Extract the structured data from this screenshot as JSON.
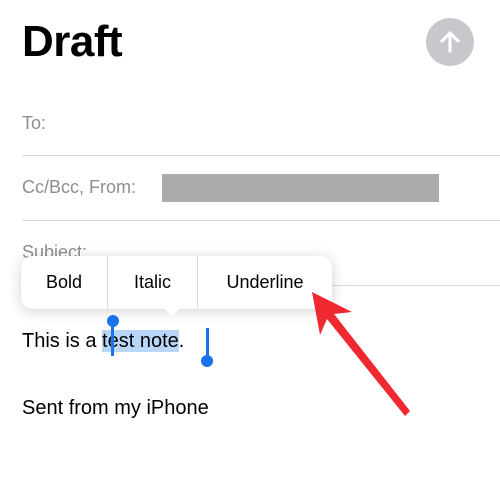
{
  "header": {
    "title": "Draft"
  },
  "fields": {
    "to_label": "To:",
    "ccbcc_label": "Cc/Bcc, From:",
    "subject_label": "Subject:"
  },
  "format_menu": {
    "items": [
      "Bold",
      "Italic",
      "Underline"
    ]
  },
  "body": {
    "prefix": "This is a ",
    "selected": "test note",
    "suffix": ".",
    "signature": "Sent from my iPhone"
  },
  "colors": {
    "selection": "#b8d6f7",
    "handle": "#1a73e8",
    "send_button": "#c7c7cc",
    "arrow": "#f0282f"
  },
  "icons": {
    "send": "arrow-up-icon"
  }
}
